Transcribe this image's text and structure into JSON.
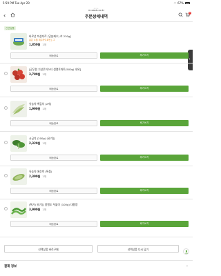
{
  "status_bar": {
    "time": "5:59 PM",
    "date": "Tue Apr 29",
    "battery": "67%"
  },
  "url": "m.oasis.co.kr",
  "header": {
    "title": "주문상세내역",
    "cart_count": "0"
  },
  "tag": "신선상품",
  "items": [
    {
      "name": "바로선 미션지르 (당분짜수) 호 230g]",
      "sub": "글은 노울 제주카이트먼], 그",
      "price": "1,850원",
      "qty": "1개",
      "left_btn": "배송완료",
      "right_btn": "후기쓰기"
    },
    {
      "name": "[공무원 기성루이스티 생열토마토(500g) 내외]",
      "sub": "",
      "price": "3,780원",
      "qty": "1개",
      "left_btn": "배송완료",
      "right_btn": "후기쓰기"
    },
    {
      "name": "유농약 백김치 (2개)",
      "sub": "",
      "price": "1,990원",
      "qty": "1개",
      "left_btn": "배송완료",
      "right_btn": "후기쓰기"
    },
    {
      "name": "시금치 (200g) (유기농",
      "sub": "",
      "price": "2,320원",
      "qty": "1개",
      "left_btn": "배송완료",
      "right_btn": "후기쓰기"
    },
    {
      "name": "유농약 애호박 (특품)",
      "sub": "",
      "price": "2,390원",
      "qty": "1개",
      "left_btn": "배송완료",
      "right_btn": "후기쓰기"
    },
    {
      "name": "(특가) 유기농 콩열도 꾸불이 (100g) 대용량",
      "sub": "",
      "price": "3,990원",
      "qty": "1개",
      "left_btn": "배송완료",
      "right_btn": "후기쓰기"
    }
  ],
  "bottom": {
    "left": "선택상품 바로구매",
    "right": "선택상품 다시 담기"
  },
  "section_title": "결제 정보"
}
